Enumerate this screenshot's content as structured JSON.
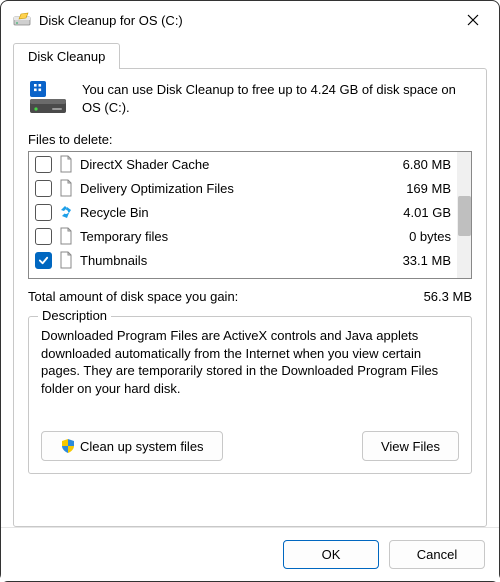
{
  "window": {
    "title": "Disk Cleanup for OS (C:)"
  },
  "tab_label": "Disk Cleanup",
  "intro": "You can use Disk Cleanup to free up to 4.24 GB of disk space on OS (C:).",
  "files_label": "Files to delete:",
  "files": [
    {
      "name": "DirectX Shader Cache",
      "size": "6.80 MB",
      "checked": false,
      "icon": "file"
    },
    {
      "name": "Delivery Optimization Files",
      "size": "169 MB",
      "checked": false,
      "icon": "file"
    },
    {
      "name": "Recycle Bin",
      "size": "4.01 GB",
      "checked": false,
      "icon": "recycle"
    },
    {
      "name": "Temporary files",
      "size": "0 bytes",
      "checked": false,
      "icon": "file"
    },
    {
      "name": "Thumbnails",
      "size": "33.1 MB",
      "checked": true,
      "icon": "file"
    }
  ],
  "total_label": "Total amount of disk space you gain:",
  "total_value": "56.3 MB",
  "description_title": "Description",
  "description_text": "Downloaded Program Files are ActiveX controls and Java applets downloaded automatically from the Internet when you view certain pages. They are temporarily stored in the Downloaded Program Files folder on your hard disk.",
  "buttons": {
    "cleanup_system": "Clean up system files",
    "view_files": "View Files",
    "ok": "OK",
    "cancel": "Cancel"
  }
}
